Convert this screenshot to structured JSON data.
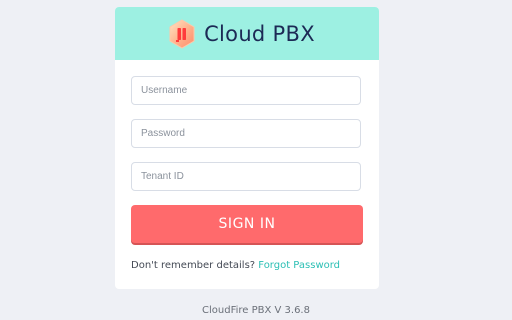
{
  "brand": {
    "name": "Cloud PBX",
    "logo_icon": "cloud-pbx-hexagon-logo",
    "header_color": "#9df0e2"
  },
  "form": {
    "username_placeholder": "Username",
    "password_placeholder": "Password",
    "tenant_placeholder": "Tenant ID",
    "signin_label": "SIGN IN",
    "signin_color": "#ff6a6c",
    "remember_text": "Don't remember details?",
    "forgot_link": "Forgot Password",
    "link_color": "#2bbfb4"
  },
  "footer": {
    "version": "CloudFire PBX V 3.6.8"
  }
}
